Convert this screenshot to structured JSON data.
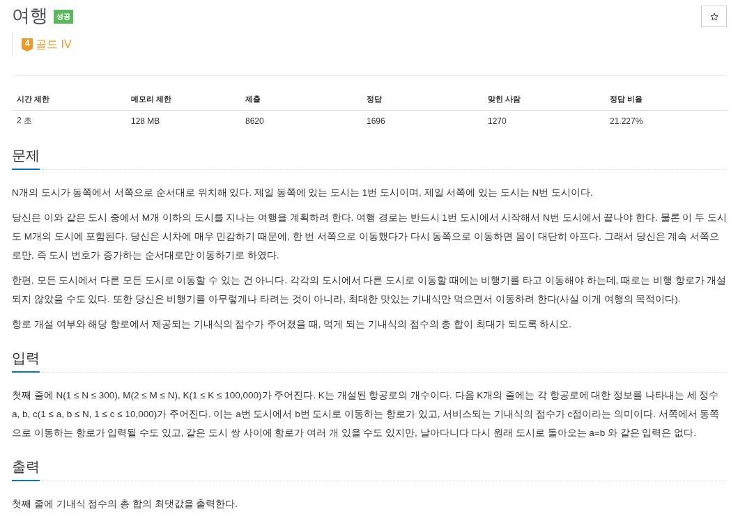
{
  "problem": {
    "title": "여행",
    "status_badge": "성공",
    "tier": {
      "level": "4",
      "label": "골드 IV"
    }
  },
  "stats": {
    "columns": [
      "시간 제한",
      "메모리 제한",
      "제출",
      "정답",
      "맞힌 사람",
      "정답 비율"
    ],
    "rows": [
      [
        "2 초",
        "128 MB",
        "8620",
        "1696",
        "1270",
        "21.227%"
      ]
    ]
  },
  "sections": [
    {
      "title": "문제",
      "paragraphs": [
        "N개의 도시가 동쪽에서 서쪽으로 순서대로 위치해 있다. 제일 동쪽에 있는 도시는 1번 도시이며, 제일 서쪽에 있는 도시는 N번 도시이다.",
        "당신은 이와 같은 도시 중에서 M개 이하의 도시를 지나는 여행을 계획하려 한다. 여행 경로는 반드시 1번 도시에서 시작해서 N번 도시에서 끝나야 한다. 물론 이 두 도시도 M개의 도시에 포함된다. 당신은 시차에 매우 민감하기 때문에, 한 번 서쪽으로 이동했다가 다시 동쪽으로 이동하면 몸이 대단히 아프다. 그래서 당신은 계속 서쪽으로만, 즉 도시 번호가 증가하는 순서대로만 이동하기로 하였다.",
        "한편, 모든 도시에서 다른 모든 도시로 이동할 수 있는 건 아니다. 각각의 도시에서 다른 도시로 이동할 때에는 비행기를 타고 이동해야 하는데, 때로는 비행 항로가 개설되지 않았을 수도 있다. 또한 당신은 비행기를 아무렇게나 타려는 것이 아니라, 최대한 맛있는 기내식만 먹으면서 이동하려 한다(사실 이게 여행의 목적이다).",
        "항로 개설 여부와 해당 항로에서 제공되는 기내식의 점수가 주어졌을 때, 먹게 되는 기내식의 점수의 총 합이 최대가 되도록 하시오."
      ]
    },
    {
      "title": "입력",
      "paragraphs": [
        "첫째 줄에 N(1 ≤ N ≤ 300), M(2 ≤ M ≤ N), K(1 ≤ K ≤ 100,000)가 주어진다. K는 개설된 항공로의 개수이다. 다음 K개의 줄에는 각 항공로에 대한 정보를 나타내는 세 정수 a, b, c(1 ≤ a, b ≤ N, 1 ≤ c ≤ 10,000)가 주어진다. 이는 a번 도시에서 b번 도시로 이동하는 항로가 있고, 서비스되는 기내식의 점수가 c점이라는 의미이다. 서쪽에서 동쪽으로 이동하는 항로가 입력될 수도 있고, 같은 도시 쌍 사이에 항로가 여러 개 있을 수도 있지만, 날아다니다 다시 원래 도시로 돌아오는 a=b 와 같은 입력은 없다."
      ]
    },
    {
      "title": "출력",
      "paragraphs": [
        "첫째 줄에 기내식 점수의 총 합의 최댓값을 출력한다."
      ]
    }
  ]
}
